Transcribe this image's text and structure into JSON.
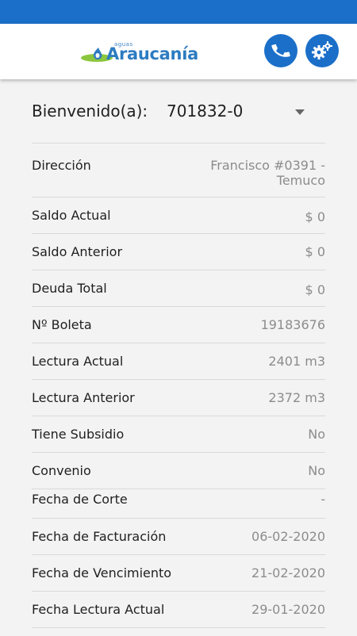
{
  "brand": {
    "small": "aguas",
    "name": "Araucanía"
  },
  "welcome": {
    "label": "Bienvenido(a):",
    "account": "701832-0"
  },
  "rows": [
    {
      "label": "Dirección",
      "value_line1": "Francisco #0391  -",
      "value_line2": "Temuco"
    },
    {
      "label": "Saldo Actual",
      "value": "$ 0"
    },
    {
      "label": "Saldo Anterior",
      "value": "$ 0"
    },
    {
      "label": "Deuda Total",
      "value": "$ 0"
    },
    {
      "label": "Nº Boleta",
      "value": "19183676"
    },
    {
      "label": "Lectura Actual",
      "value": "2401 m3"
    },
    {
      "label": "Lectura Anterior",
      "value": "2372 m3"
    },
    {
      "label": "Tiene Subsidio",
      "value": "No"
    },
    {
      "label": "Convenio",
      "value": "No"
    },
    {
      "label": "Fecha de Corte",
      "value": "-"
    },
    {
      "label": "Fecha de Facturación",
      "value": "06-02-2020"
    },
    {
      "label": "Fecha de Vencimiento",
      "value": "21-02-2020"
    },
    {
      "label": "Fecha Lectura Actual",
      "value": "29-01-2020"
    }
  ]
}
